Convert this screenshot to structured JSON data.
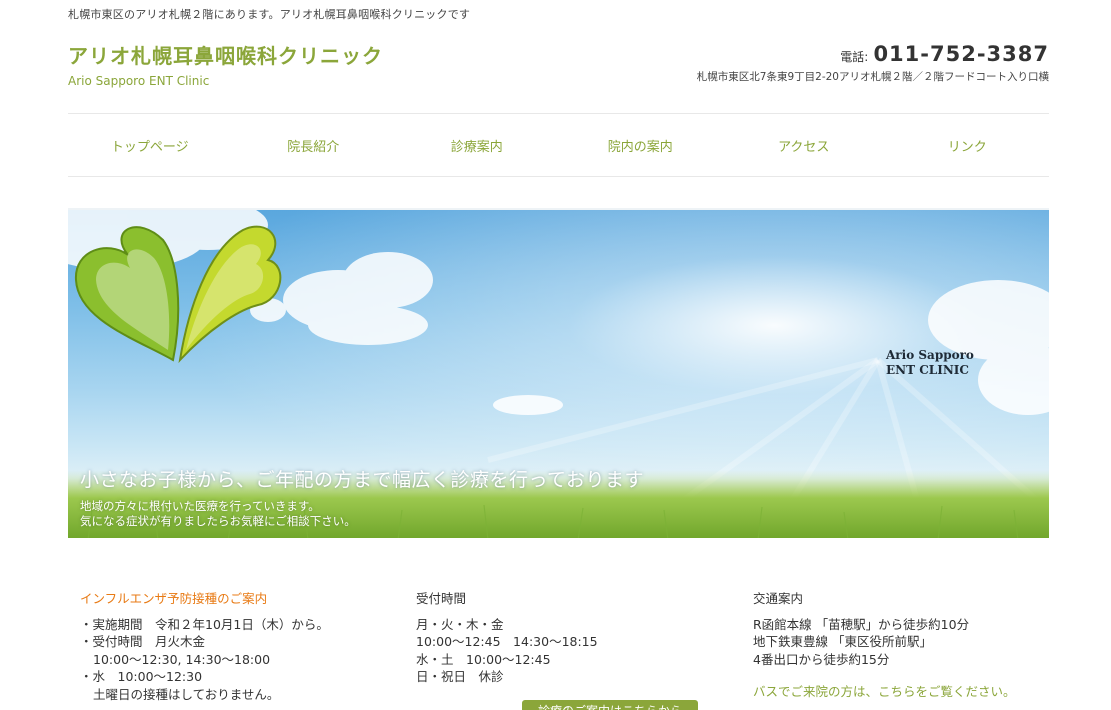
{
  "header": {
    "tagline": "札幌市東区のアリオ札幌２階にあります。アリオ札幌耳鼻咽喉科クリニックです",
    "clinic_name": "アリオ札幌耳鼻咽喉科クリニック",
    "clinic_name_en": "Ario Sapporo ENT Clinic",
    "phone_label": "電話:",
    "phone_number": "011-752-3387",
    "address": "札幌市東区北7条東9丁目2-20アリオ札幌２階／２階フードコート入り口横"
  },
  "nav": {
    "items": [
      {
        "label": "トップページ"
      },
      {
        "label": "院長紹介"
      },
      {
        "label": "診療案内"
      },
      {
        "label": "院内の案内"
      },
      {
        "label": "アクセス"
      },
      {
        "label": "リンク"
      }
    ]
  },
  "hero": {
    "heading": "小さなお子様から、ご年配の方まで幅広く診療を行っております",
    "text_line1": "地域の方々に根付いた医療を行っていきます。",
    "text_line2": "気になる症状が有りましたらお気軽にご相談下さい。",
    "logo_line1": "Ario Sapporo",
    "logo_line2": "ENT CLINIC"
  },
  "info": {
    "flu": {
      "title": "インフルエンザ予防接種のご案内",
      "lines": [
        "・実施期間　令和２年10月1日（木）から。",
        "・受付時間　月火木金",
        "10:00～12:30, 14:30～18:00",
        "・水　10:00～12:30",
        "土曜日の接種はしておりません。"
      ]
    },
    "hours": {
      "title": "受付時間",
      "lines": [
        "月・火・木・金",
        "10:00～12:45　14:30～18:15",
        "水・土　10:00～12:45",
        "日・祝日　休診"
      ],
      "button_label": "診療のご案内はこちらから"
    },
    "access": {
      "title": "交通案内",
      "lines": [
        "R函館本線 「苗穂駅」から徒歩約10分",
        "地下鉄東豊線 「東区役所前駅」",
        "4番出口から徒歩約15分"
      ],
      "bus_link": "バスでご来院の方は、こちらをご覧ください。"
    }
  },
  "colors": {
    "brand_green": "#8ba63a",
    "notice_orange": "#e87a14"
  }
}
